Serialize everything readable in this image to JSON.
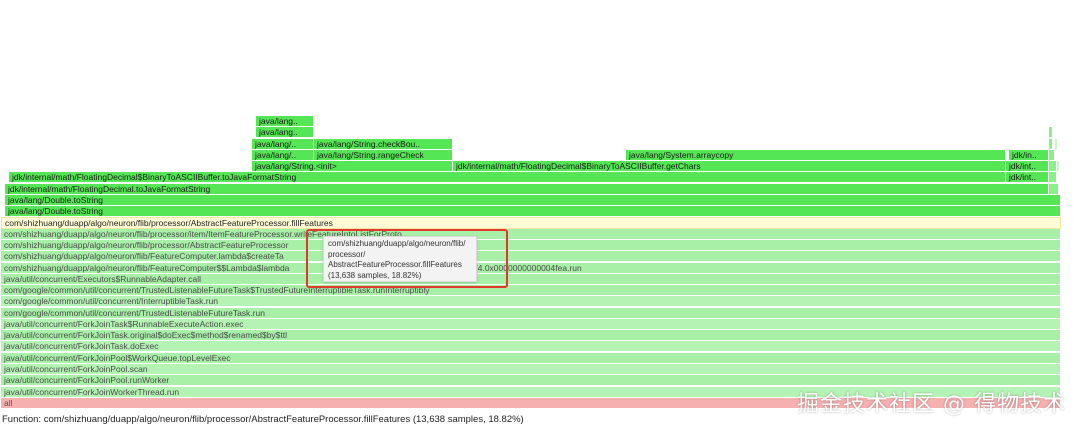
{
  "frames": {
    "f1": "java/lang..",
    "f2": "java/lang..",
    "f3": "java/lang/..",
    "f4": "java/lang/String.checkBou..",
    "f5": "java/lang/..",
    "f6": "java/lang/String.rangeCheck",
    "f7": "java/lang/System.arraycopy",
    "f8": "jdk/in..",
    "f9": "java/lang/String.<init>",
    "f10": "jdk/internal/math/FloatingDecimal$BinaryToASCIIBuffer.getChars",
    "f11": "jdk/int..",
    "f12": "jdk/internal/math/FloatingDecimal$BinaryToASCIIBuffer.toJavaFormatString",
    "f13": "jdk/int..",
    "f14": "jdk/internal/math/FloatingDecimal.toJavaFormatString",
    "f15": "java/lang/Double.toString",
    "f16": "java/lang/Double.toString",
    "f17": "com/shizhuang/duapp/algo/neuron/flib/processor/AbstractFeatureProcessor.fillFeatures",
    "f18": "com/shizhuang/duapp/algo/neuron/flib/processor/item/ItemFeatureProcessor.writeFeatureIntoListForProto",
    "f19": "com/shizhuang/duapp/algo/neuron/flib/processor/AbstractFeatureProcessor",
    "f20": "com/shizhuang/duapp/algo/neuron/flib/FeatureComputer.lambda$createTa",
    "f21": "com/shizhuang/duapp/algo/neuron/flib/FeatureComputer$$Lambda$lambda",
    "f21b": "74.0x0000000000004fea.run",
    "f22": "java/util/concurrent/Executors$RunnableAdapter.call",
    "f23": "com/google/common/util/concurrent/TrustedListenableFutureTask$TrustedFutureInterruptibleTask.runInterruptibly",
    "f24": "com/google/common/util/concurrent/InterruptibleTask.run",
    "f25": "com/google/common/util/concurrent/TrustedListenableFutureTask.run",
    "f26": "java/util/concurrent/ForkJoinTask$RunnableExecuteAction.exec",
    "f27": "java/util/concurrent/ForkJoinTask.original$doExec$method$renamed$by$ttl",
    "f28": "java/util/concurrent/ForkJoinTask.doExec",
    "f29": "java/util/concurrent/ForkJoinPool$WorkQueue.topLevelExec",
    "f30": "java/util/concurrent/ForkJoinPool.scan",
    "f31": "java/util/concurrent/ForkJoinPool.runWorker",
    "f32": "java/util/concurrent/ForkJoinWorkerThread.run",
    "f33": "all"
  },
  "tooltip": {
    "line1": "com/shizhuang/duapp/algo/neuron/flib/",
    "line2": "processor/",
    "line3": "AbstractFeatureProcessor.fillFeatures",
    "line4": "(13,638 samples, 18.82%)"
  },
  "status": "Function: com/shizhuang/duapp/algo/neuron/flib/processor/AbstractFeatureProcessor.fillFeatures (13,638 samples, 18.82%)",
  "watermark": "掘金技术社区 @ 得物技术",
  "colors": {
    "hot_frame": "#55e655",
    "selected_frame": "#fffbd6",
    "dimmed_frame": "#a8f0a8",
    "root_frame": "#f7b0b0",
    "highlight_box": "#e03a2e"
  }
}
